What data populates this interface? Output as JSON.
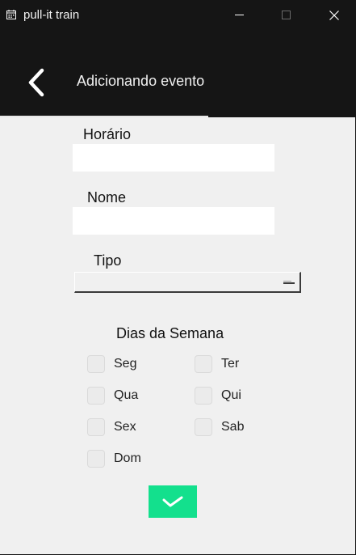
{
  "window": {
    "title": "pull-it train",
    "icon": "calendar-icon"
  },
  "header": {
    "title": "Adicionando evento",
    "back_icon": "chevron-left-icon"
  },
  "form": {
    "horario_label": "Horário",
    "horario_value": "",
    "nome_label": "Nome",
    "nome_value": "",
    "tipo_label": "Tipo",
    "tipo_selected": "",
    "days_title": "Dias da Semana",
    "days": [
      {
        "label": "Seg",
        "checked": false
      },
      {
        "label": "Ter",
        "checked": false
      },
      {
        "label": "Qua",
        "checked": false
      },
      {
        "label": "Qui",
        "checked": false
      },
      {
        "label": "Sex",
        "checked": false
      },
      {
        "label": "Sab",
        "checked": false
      },
      {
        "label": "Dom",
        "checked": false
      }
    ],
    "confirm_icon": "checkmark-icon"
  },
  "colors": {
    "titlebar_bg": "#151515",
    "content_bg": "#f0f0f0",
    "accent": "#13e08d"
  }
}
